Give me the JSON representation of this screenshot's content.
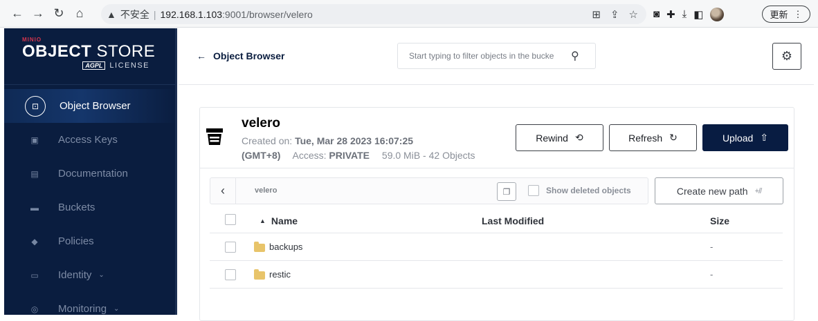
{
  "browser": {
    "security_label": "不安全",
    "url_host": "192.168.1.103",
    "url_rest": ":9001/browser/velero",
    "update_label": "更新"
  },
  "sidebar": {
    "logo_top": "MINIO",
    "logo_bold": "OBJECT",
    "logo_light": " STORE",
    "logo_badge": "AGPL",
    "logo_license": "LICENSE",
    "items": [
      {
        "label": "Object Browser",
        "icon": "object-browser-icon",
        "active": true
      },
      {
        "label": "Access Keys",
        "icon": "access-keys-icon"
      },
      {
        "label": "Documentation",
        "icon": "documentation-icon"
      },
      {
        "label": "Buckets",
        "icon": "buckets-icon"
      },
      {
        "label": "Policies",
        "icon": "policies-icon"
      },
      {
        "label": "Identity",
        "icon": "identity-icon",
        "expandable": true
      },
      {
        "label": "Monitoring",
        "icon": "monitoring-icon",
        "expandable": true
      }
    ]
  },
  "header": {
    "back_label": "Object Browser",
    "filter_placeholder": "Start typing to filter objects in the bucke"
  },
  "bucket": {
    "name": "velero",
    "created_label": "Created on:",
    "created_value": "Tue, Mar 28 2023 16:07:25",
    "timezone": "(GMT+8)",
    "access_label": "Access:",
    "access_value": "PRIVATE",
    "summary": "59.0 MiB - 42 Objects"
  },
  "actions": {
    "rewind": "Rewind",
    "refresh": "Refresh",
    "upload": "Upload",
    "create_path": "Create new path"
  },
  "pathbar": {
    "path": "velero",
    "show_deleted": "Show deleted objects"
  },
  "table": {
    "columns": {
      "name": "Name",
      "modified": "Last Modified",
      "size": "Size"
    },
    "rows": [
      {
        "name": "backups",
        "modified": "",
        "size": "-"
      },
      {
        "name": "restic",
        "modified": "",
        "size": "-"
      }
    ]
  },
  "colors": {
    "sidebar_bg": "#0a1d3f",
    "primary_button": "#081c42",
    "folder": "#e8c46a"
  }
}
